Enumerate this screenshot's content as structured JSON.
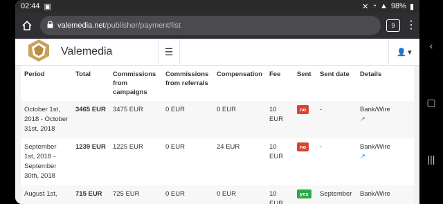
{
  "status": {
    "time": "02:44",
    "battery": "98%"
  },
  "browser": {
    "url_domain": "valemedia.net",
    "url_path": "/publisher/payment/list",
    "tab_count": "9"
  },
  "app": {
    "brand": "Valemedia"
  },
  "table": {
    "headers": [
      "Period",
      "Total",
      "Commissions from campaigns",
      "Commissions from referrals",
      "Compensation",
      "Fee",
      "Sent",
      "Sent date",
      "Details"
    ],
    "rows": [
      {
        "period": "October 1st, 2018 - October 31st, 2018",
        "total": "3465 EUR",
        "campaigns": "3475 EUR",
        "referrals": "0 EUR",
        "compensation": "0 EUR",
        "fee": "10 EUR",
        "sent": "no",
        "sent_date": "-",
        "details": "Bank/Wire"
      },
      {
        "period": "September 1st, 2018 - September 30th, 2018",
        "total": "1239 EUR",
        "campaigns": "1225 EUR",
        "referrals": "0 EUR",
        "compensation": "24 EUR",
        "fee": "10 EUR",
        "sent": "no",
        "sent_date": "-",
        "details": "Bank/Wire"
      },
      {
        "period": "August 1st,",
        "total": "715 EUR",
        "campaigns": "725 EUR",
        "referrals": "0 EUR",
        "compensation": "0 EUR",
        "fee": "10 EUR",
        "sent": "yes",
        "sent_date": "September",
        "details": "Bank/Wire"
      }
    ]
  },
  "colors": {
    "no": "#d9442f",
    "yes": "#2ba84a",
    "link": "#3a8fd8"
  }
}
